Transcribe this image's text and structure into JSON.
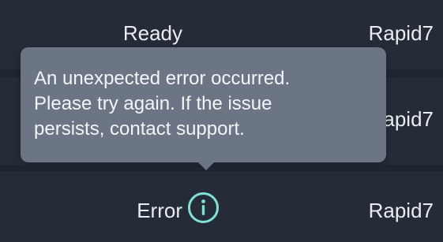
{
  "table": {
    "rows": [
      {
        "status": "Ready",
        "vendor": "Rapid7"
      },
      {
        "status": "",
        "vendor": "Rapid7"
      },
      {
        "status": "Error",
        "vendor": "Rapid7",
        "status_icon": "info-icon"
      }
    ]
  },
  "tooltip": {
    "text": "An unexpected error occurred.\nPlease try again. If the issue\npersists, contact support."
  },
  "colors": {
    "background": "#1f2530",
    "row_background": "#252c37",
    "tooltip_background": "#6c7584",
    "info_icon": "#7fe0d6"
  }
}
